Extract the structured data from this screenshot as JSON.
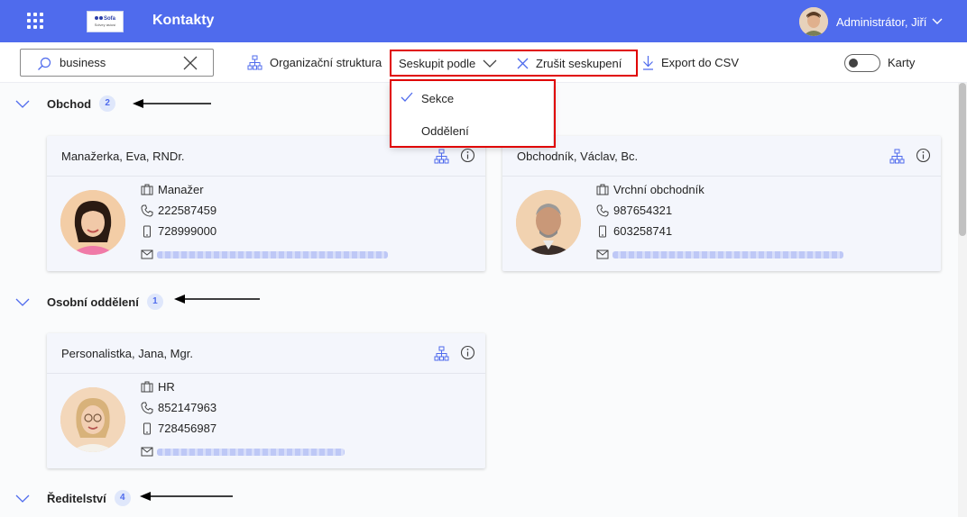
{
  "header": {
    "app_title": "Kontakty",
    "logo_line1": "Sofa",
    "logo_line2": "Solvey ásíusí",
    "user_name": "Administrátor, Jiří",
    "accent_color": "#4f6bed"
  },
  "toolbar": {
    "search_value": "business",
    "org_structure_label": "Organizační struktura",
    "group_by_label": "Seskupit podle",
    "cancel_grouping_label": "Zrušit seskupení",
    "export_label": "Export do CSV",
    "cards_toggle_label": "Karty",
    "cards_toggle_on": false
  },
  "group_by_menu": {
    "items": [
      {
        "label": "Sekce",
        "selected": true
      },
      {
        "label": "Oddělení",
        "selected": false
      }
    ]
  },
  "groups": [
    {
      "name": "Obchod",
      "count": "2",
      "contacts": [
        {
          "name": "Manažerka, Eva, RNDr.",
          "title": "Manažer",
          "phone": "222587459",
          "mobile": "728999000"
        },
        {
          "name": "Obchodník, Václav, Bc.",
          "title": "Vrchní obchodník",
          "phone": "987654321",
          "mobile": "603258741"
        }
      ]
    },
    {
      "name": "Osobní oddělení",
      "count": "1",
      "contacts": [
        {
          "name": "Personalistka, Jana, Mgr.",
          "title": "HR",
          "phone": "852147963",
          "mobile": "728456987"
        }
      ]
    },
    {
      "name": "Ředitelství",
      "count": "4",
      "contacts": []
    }
  ]
}
